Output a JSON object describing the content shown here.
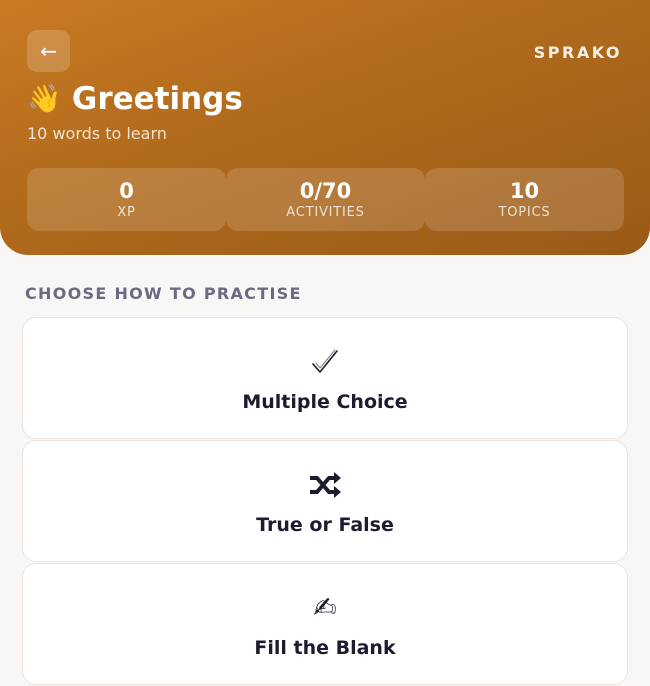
{
  "header": {
    "back_icon": "←",
    "brand": "SPRAKO",
    "title_icon": "👋",
    "title": "Greetings",
    "subtitle": "10 words to learn"
  },
  "stats": [
    {
      "value": "0",
      "label": "XP"
    },
    {
      "value": "0/70",
      "label": "ACTIVITIES"
    },
    {
      "value": "10",
      "label": "TOPICS"
    }
  ],
  "section": {
    "label": "CHOOSE HOW TO PRACTISE"
  },
  "modes": [
    {
      "icon": "✅",
      "icon_name": "check-icon",
      "label": "Multiple Choice"
    },
    {
      "icon": "🔀",
      "icon_name": "shuffle-icon",
      "label": "True or False"
    },
    {
      "icon": "✍",
      "icon_name": "writing-hand-icon",
      "label": "Fill the Blank"
    }
  ],
  "colors": {
    "hero_start": "#c97a22",
    "hero_end": "#9a5a18",
    "background": "#f9f7f5",
    "text_dark": "#1c1c2e",
    "section_label": "#6b6a80"
  }
}
